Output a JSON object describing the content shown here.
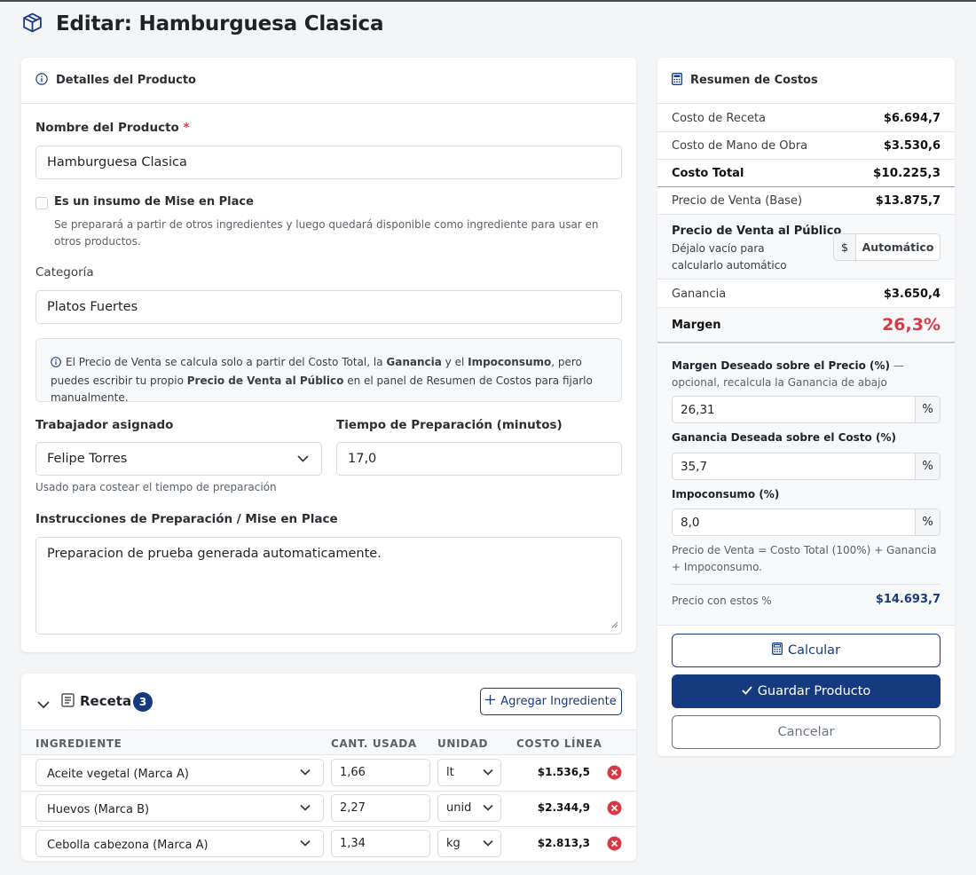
{
  "page": {
    "title": "Editar: Hamburguesa Clasica"
  },
  "details": {
    "header": "Detalles del Producto",
    "name_label": "Nombre del Producto",
    "required_mark": "*",
    "name_value": "Hamburguesa Clasica",
    "mise_checkbox_label": "Es un insumo de Mise en Place",
    "mise_checked": false,
    "mise_help": "Se preparará a partir de otros ingredientes y luego quedará disponible como ingrediente para usar en otros productos.",
    "category_label": "Categoría",
    "category_value": "Platos Fuertes",
    "info": {
      "t1": "El Precio de Venta se calcula solo a partir del Costo Total, la ",
      "b1": "Ganancia",
      "t2": " y el ",
      "b2": "Impoconsumo",
      "t3": ", pero puedes escribir tu propio ",
      "b3": "Precio de Venta al Público",
      "t4": " en el panel de Resumen de Costos para fijarlo manualmente."
    },
    "worker_label": "Trabajador asignado",
    "worker_value": "Felipe Torres",
    "worker_help": "Usado para costear el tiempo de preparación",
    "prep_time_label": "Tiempo de Preparación (minutos)",
    "prep_time_value": "17,0",
    "instructions_label": "Instrucciones de Preparación / Mise en Place",
    "instructions_value": "Preparacion de prueba generada automaticamente."
  },
  "recipe": {
    "title": "Receta",
    "count": "3",
    "add_button": "Agregar Ingrediente",
    "columns": [
      "INGREDIENTE",
      "CANT. USADA",
      "UNIDAD",
      "COSTO LÍNEA"
    ],
    "rows": [
      {
        "ingredient": "Aceite vegetal (Marca A)",
        "qty": "1,66",
        "unit": "lt",
        "cost": "$1.536,5"
      },
      {
        "ingredient": "Huevos (Marca B)",
        "qty": "2,27",
        "unit": "unid",
        "cost": "$2.344,9"
      },
      {
        "ingredient": "Cebolla cabezona (Marca A)",
        "qty": "1,34",
        "unit": "kg",
        "cost": "$2.813,3"
      }
    ]
  },
  "summary": {
    "header": "Resumen de Costos",
    "recipe_cost_label": "Costo de Receta",
    "recipe_cost": "$6.694,7",
    "labor_cost_label": "Costo de Mano de Obra",
    "labor_cost": "$3.530,6",
    "total_cost_label": "Costo Total",
    "total_cost": "$10.225,3",
    "base_price_label": "Precio de Venta (Base)",
    "base_price": "$13.875,7",
    "public_price_label": "Precio de Venta al Público",
    "public_price_help": "Déjalo vacío para calcularlo automático",
    "currency_prefix": "$",
    "public_price_placeholder": "Automático",
    "profit_label": "Ganancia",
    "profit": "$3.650,4",
    "margin_label": "Margen",
    "margin": "26,3%",
    "desired_margin_label": "Margen Deseado sobre el Precio (%)",
    "desired_margin_hint": " — opcional, recalcula la Ganancia de abajo",
    "desired_margin_value": "26,31",
    "desired_profit_label": "Ganancia Deseada sobre el Costo (%)",
    "desired_profit_value": "35,7",
    "impoconsumo_label": "Impoconsumo (%)",
    "impoconsumo_value": "8,0",
    "percent_suffix": "%",
    "formula": "Precio de Venta = Costo Total (100%) + Ganancia + Impoconsumo.",
    "price_with_label": "Precio con estos %",
    "price_with": "$14.693,7",
    "calc_button": "Calcular",
    "save_button": "Guardar Producto",
    "cancel_button": "Cancelar"
  },
  "colors": {
    "primary": "#153a80",
    "danger": "#d63a45",
    "margin": "#d63a45",
    "border": "#d7dbe0"
  },
  "icons": [
    "box-icon",
    "info-icon",
    "calculator-icon",
    "chevron-down-icon",
    "list-icon",
    "plus-icon",
    "check-icon",
    "remove-icon"
  ]
}
